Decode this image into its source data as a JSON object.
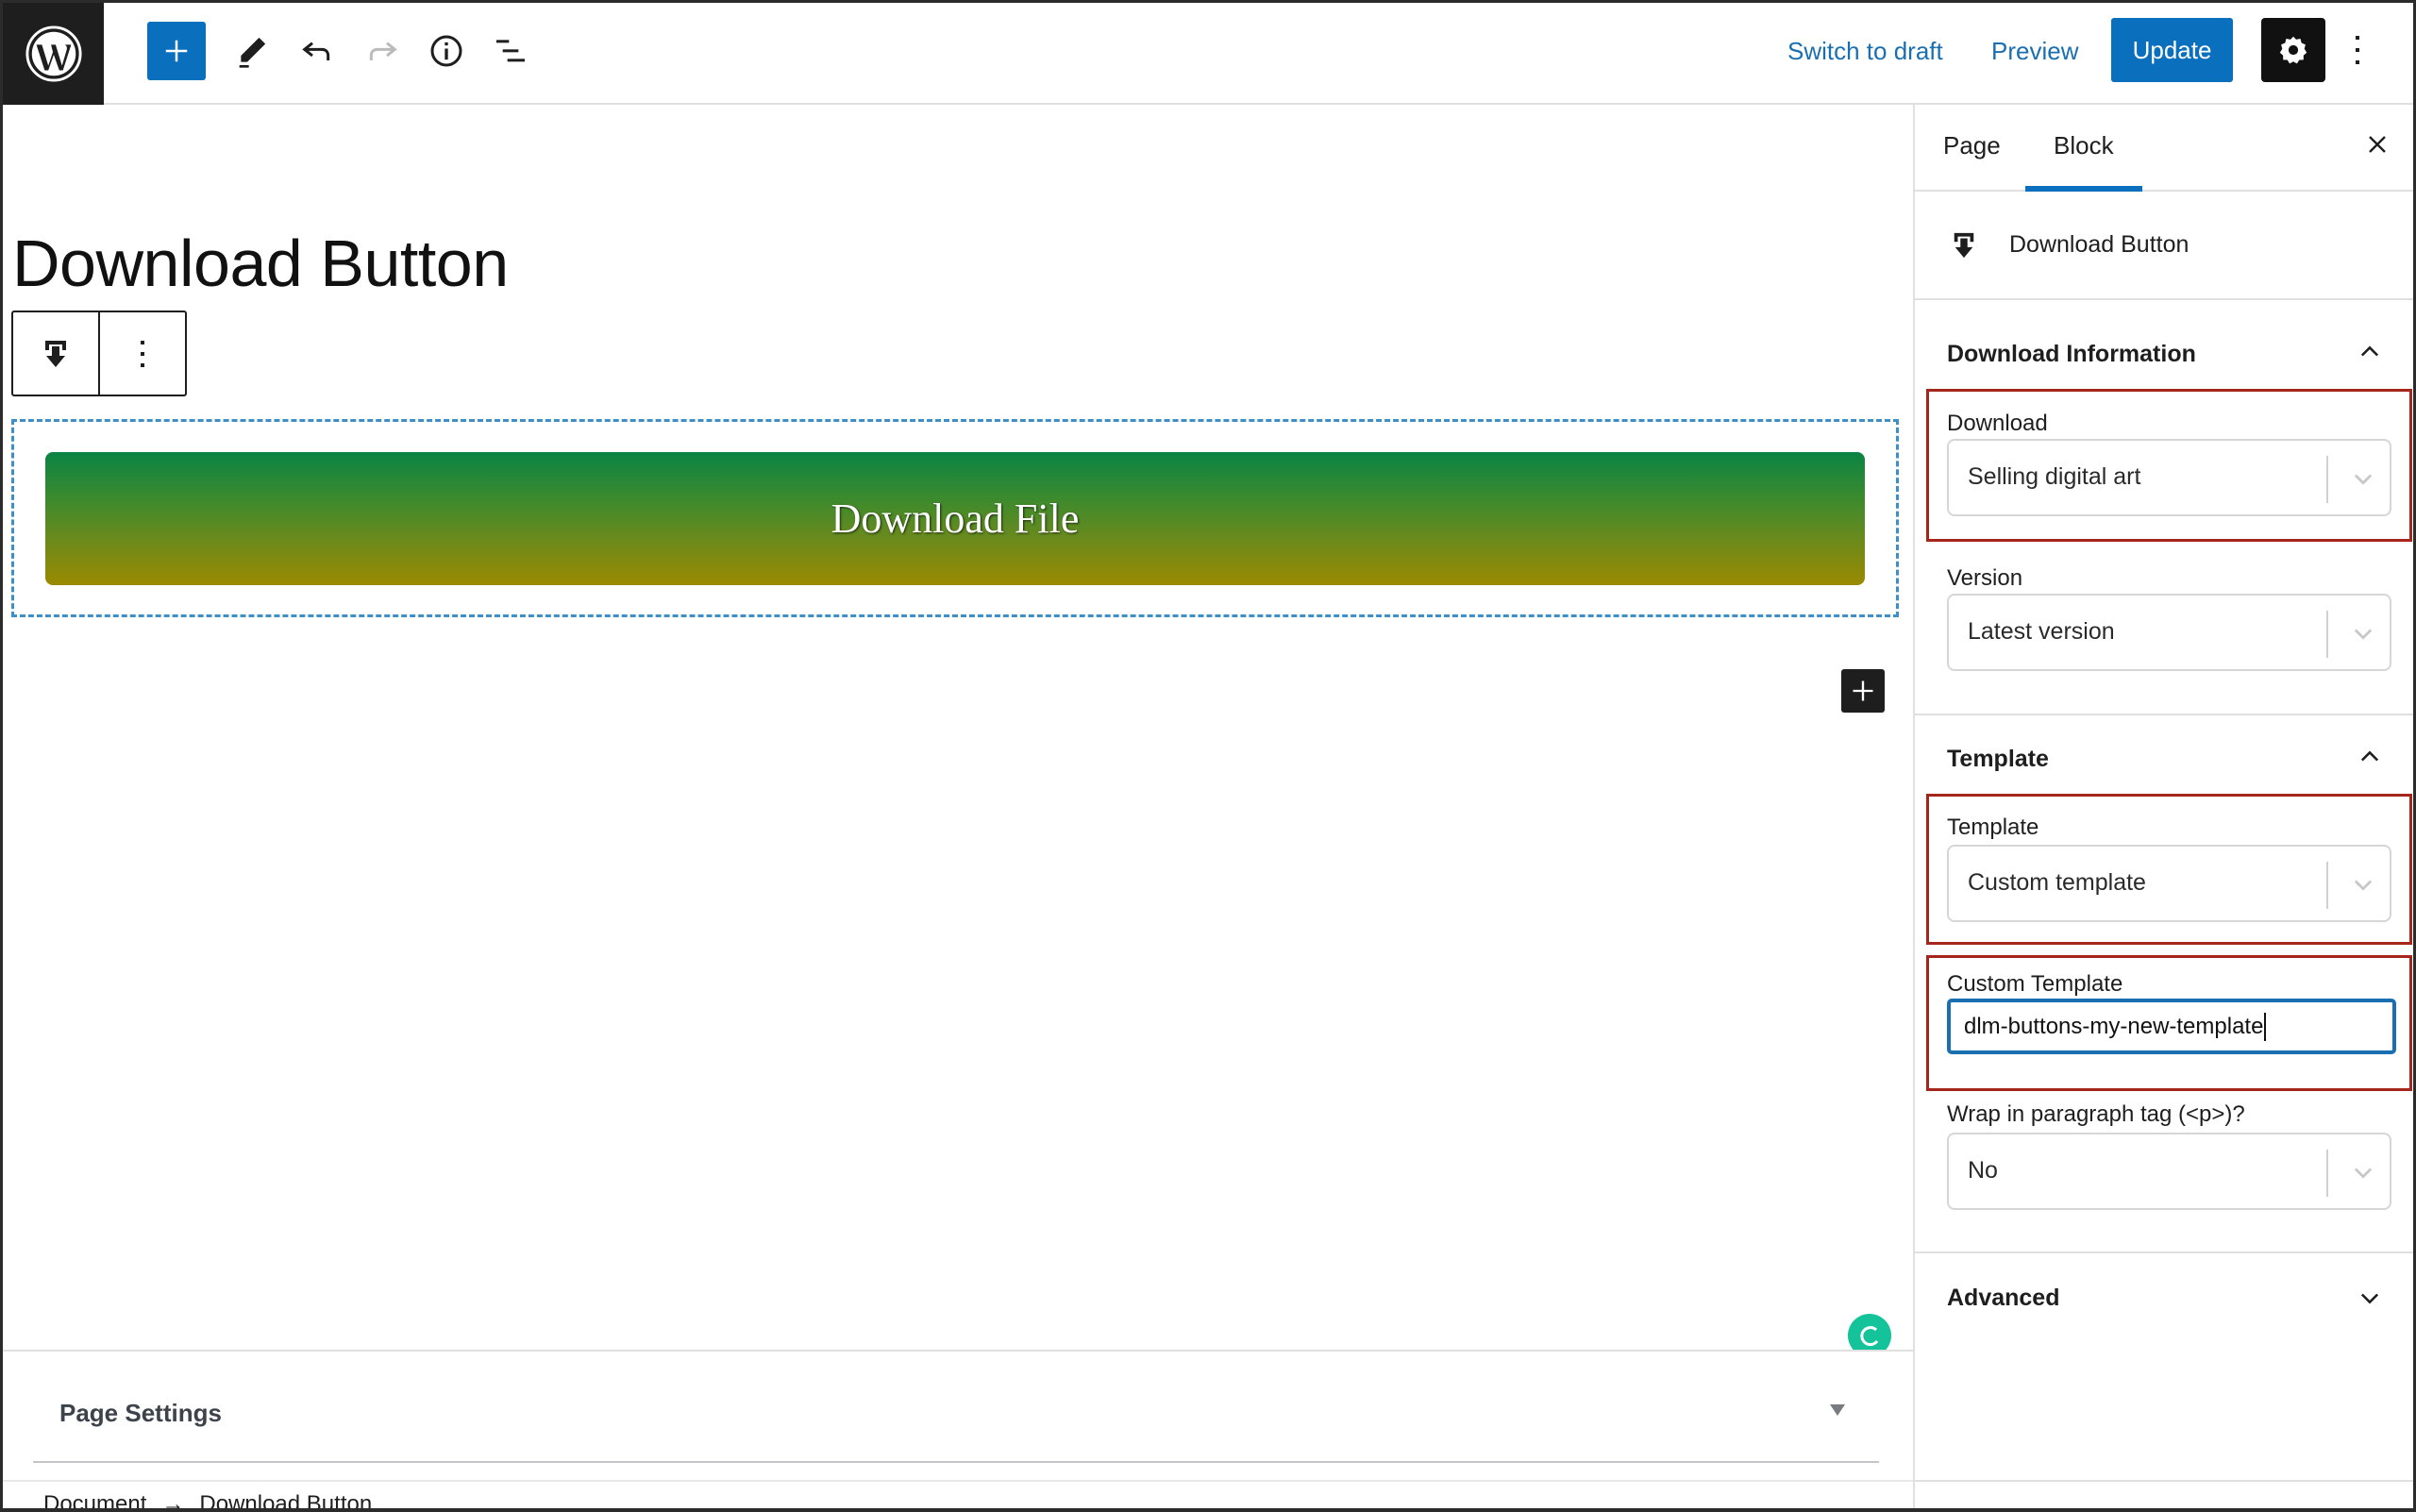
{
  "header": {
    "logo": "wordpress-logo",
    "inserter_icon": "plus-icon",
    "tools_icon": "pencil-icon",
    "undo_icon": "undo-icon",
    "redo_icon": "redo-icon",
    "details_icon": "info-icon",
    "list_view_icon": "list-view-icon",
    "switch_to_draft": "Switch to draft",
    "preview": "Preview",
    "update": "Update",
    "settings_icon": "gear-icon",
    "options_icon": "kebab-icon"
  },
  "editor": {
    "page_title": "Download Button",
    "block_toolbar": {
      "block_icon": "download-block-icon",
      "options_icon": "kebab-icon"
    },
    "download_button_label": "Download File",
    "button_gradient": [
      "#0a8444",
      "#9a8a00"
    ],
    "selection_outline_color": "#3f8fc7",
    "appender_icon": "plus-icon",
    "page_settings": {
      "title": "Page Settings",
      "toggle_icon": "caret-down-icon"
    },
    "breadcrumb": {
      "items": [
        "Document",
        "Download Button"
      ],
      "separator": "→"
    }
  },
  "sidebar": {
    "tabs": [
      {
        "label": "Page",
        "active": false
      },
      {
        "label": "Block",
        "active": true
      }
    ],
    "close_icon": "close-icon",
    "block_card": {
      "icon": "download-block-icon",
      "title": "Download Button"
    },
    "panels": {
      "download_information": {
        "title": "Download Information",
        "expanded": true,
        "fields": {
          "download": {
            "label": "Download",
            "value": "Selling digital art"
          },
          "version": {
            "label": "Version",
            "value": "Latest version"
          }
        }
      },
      "template": {
        "title": "Template",
        "expanded": true,
        "fields": {
          "template": {
            "label": "Template",
            "value": "Custom template"
          },
          "custom_template": {
            "label": "Custom Template",
            "value": "dlm-buttons-my-new-template"
          },
          "wrap_in_paragraph": {
            "label": "Wrap in paragraph tag (<p>)?",
            "value": "No"
          }
        }
      },
      "advanced": {
        "title": "Advanced",
        "expanded": false
      }
    }
  },
  "colors": {
    "accent": "#0a6fbd",
    "highlight_annotation": "#a6261c",
    "grammarly": "#15c39a"
  }
}
